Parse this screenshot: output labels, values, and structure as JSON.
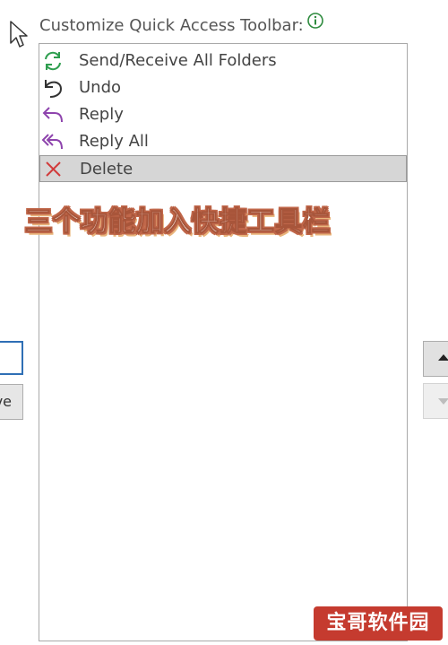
{
  "toolbar_label": "Customize Quick Access Toolbar:",
  "icons": {
    "info": "info-icon",
    "cursor": "mouse-pointer-icon"
  },
  "list": {
    "items": [
      {
        "label": "Send/Receive All Folders",
        "icon": "send-receive-icon",
        "icon_color": "#2e9e4f",
        "selected": false
      },
      {
        "label": "Undo",
        "icon": "undo-icon",
        "icon_color": "#333333",
        "selected": false
      },
      {
        "label": "Reply",
        "icon": "reply-icon",
        "icon_color": "#8e44ad",
        "selected": false
      },
      {
        "label": "Reply All",
        "icon": "reply-all-icon",
        "icon_color": "#8e44ad",
        "selected": false
      },
      {
        "label": "Delete",
        "icon": "delete-x-icon",
        "icon_color": "#d13b3b",
        "selected": true
      }
    ]
  },
  "caption_overlay": "三个功能加入快捷工具栏",
  "left_button_partial": "ve",
  "watermark_text": "宝哥软件园",
  "colors": {
    "selection_bg": "#d6d6d6",
    "focus_border": "#2f6fb5",
    "watermark_bg": "#c53b2f",
    "caption_stroke": "#c0674a"
  }
}
